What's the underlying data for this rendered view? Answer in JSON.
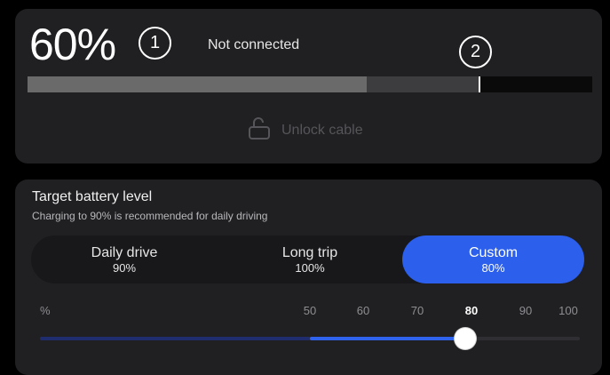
{
  "charge": {
    "percent_label": "60%",
    "level": 0.6,
    "connection_status": "Not connected",
    "target_level": 0.8,
    "unlock_label": "Unlock cable"
  },
  "callouts": [
    "1",
    "2"
  ],
  "target": {
    "title": "Target battery level",
    "subtitle": "Charging to 90% is recommended for daily driving",
    "options": [
      {
        "label": "Daily drive",
        "value": "90%",
        "selected": false
      },
      {
        "label": "Long trip",
        "value": "100%",
        "selected": true
      },
      {
        "label": "Custom",
        "value": "80%",
        "selected": true
      }
    ],
    "scale": {
      "unit": "%",
      "ticks": [
        "50",
        "60",
        "70",
        "80",
        "90",
        "100"
      ],
      "active_tick": "80",
      "min": 50,
      "max": 100,
      "value": 80
    }
  },
  "colors": {
    "accent": "#2b5fec",
    "card": "#202022",
    "background": "#000000"
  }
}
